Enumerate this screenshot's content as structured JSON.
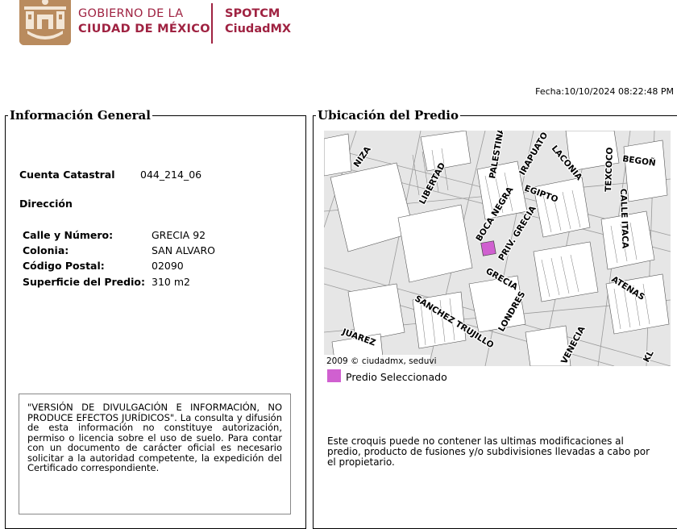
{
  "header": {
    "gov_line1": "GOBIERNO DE LA",
    "gov_line2": "CIUDAD DE MÉXICO",
    "app_line1": "SPOTCM",
    "app_line2": "CiudadMX",
    "brand_color": "#9f2241",
    "seal_color": "#b98b5e"
  },
  "fecha": "Fecha:10/10/2024 08:22:48 PM",
  "info": {
    "legend": "Información General",
    "cuenta_label": "Cuenta Catastral",
    "cuenta_value": "044_214_06",
    "direccion_label": "Dirección",
    "fields": [
      {
        "label": "Calle y Número:",
        "value": "GRECIA 92"
      },
      {
        "label": "Colonia:",
        "value": "SAN ALVARO"
      },
      {
        "label": "Código Postal:",
        "value": "02090"
      },
      {
        "label": "Superficie del Predio:",
        "value": "310 m2"
      }
    ],
    "disclaimer": "\"VERSIÓN DE DIVULGACIÓN E INFORMACIÓN, NO PRODUCE EFECTOS JURÍDICOS\". La consulta y difusión de esta información no constituye autorización, permiso o licencia sobre el uso de suelo. Para contar con un documento de carácter oficial es necesario solicitar a la autoridad competente, la expedición del Certificado correspondiente."
  },
  "ubicacion": {
    "legend": "Ubicación del Predio",
    "streets": {
      "niza": "NIZA",
      "palestina": "PALESTINA",
      "irapuato": "IRAPUATO",
      "laconia": "LACONIA",
      "texcoco": "TEXCOCO",
      "begona": "BEGOÑ",
      "libertad": "LIBERTAD",
      "egipto": "EGIPTO",
      "calle_itaca": "CALLE ITACA",
      "boca_negra": "BOCA NEGRA",
      "priv_grecia": "PRIV. GRECIA",
      "grecia": "GRECIA",
      "atenas": "ATENAS",
      "sanchez_trujillo": "SANCHEZ TRUJILLO",
      "londres": "LONDRES",
      "juarez": "JUAREZ",
      "venecia": "VENECIA",
      "kl": "KL"
    },
    "copyright": "2009 © ciudadmx, seduvi",
    "selected_color": "#d060d0",
    "legend_text": "Predio Seleccionado",
    "note": "Este croquis puede no contener las ultimas modificaciones al predio, producto de fusiones y/o subdivisiones llevadas a cabo por el propietario."
  }
}
